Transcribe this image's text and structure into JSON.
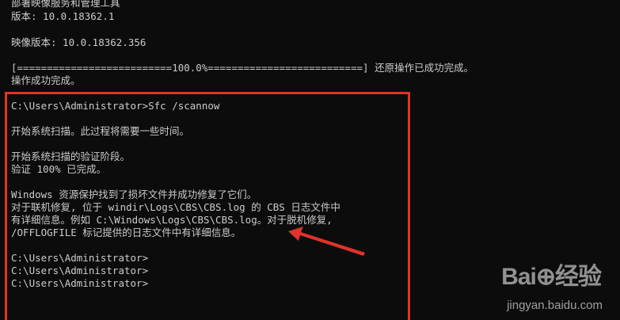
{
  "console": {
    "lines": [
      "部署映像服务和管理工具",
      "版本: 10.0.18362.1",
      "映像版本: 10.0.18362.356",
      "[==========================100.0%==========================] 还原操作已成功完成。",
      "操作成功完成。",
      "C:\\Users\\Administrator>Sfc /scannow",
      "开始系统扫描。此过程将需要一些时间。",
      "开始系统扫描的验证阶段。",
      "验证 100% 已完成。",
      "Windows 资源保护找到了损坏文件并成功修复了它们。",
      "对于联机修复, 位于 windir\\Logs\\CBS\\CBS.log 的 CBS 日志文件中",
      "有详细信息。例如 C:\\Windows\\Logs\\CBS\\CBS.log。对于脱机修复,",
      "/OFFLOGFILE 标记提供的日志文件中有详细信息。",
      "C:\\Users\\Administrator>",
      "C:\\Users\\Administrator>",
      "C:\\Users\\Administrator>"
    ]
  },
  "annotation": {
    "box_color": "#e0332b",
    "arrow_color": "#e0332b"
  },
  "watermark": {
    "logo_text": "Bai⊕经验",
    "url_text": "jingyan.baidu.com"
  },
  "colors": {
    "background": "#0c0c0c",
    "text": "#cccccc"
  }
}
